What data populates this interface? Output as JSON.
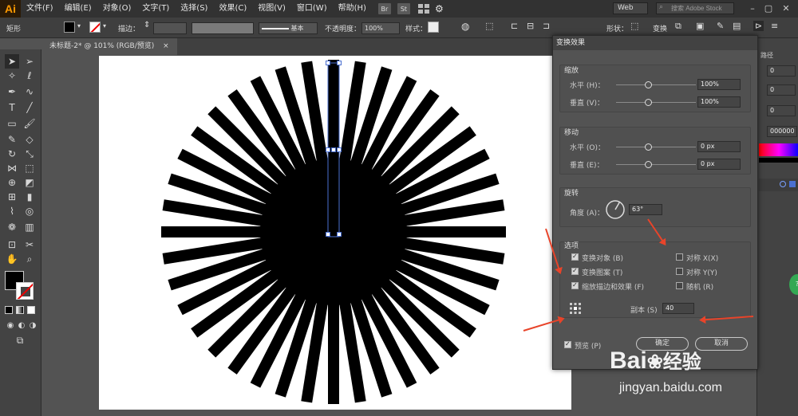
{
  "app": {
    "logo": "Ai",
    "menu": [
      "文件(F)",
      "编辑(E)",
      "对象(O)",
      "文字(T)",
      "选择(S)",
      "效果(C)",
      "视图(V)",
      "窗口(W)",
      "帮助(H)"
    ],
    "bridge_btn": "Br",
    "stock_btn": "St",
    "workspace": "Web",
    "stock_search_placeholder": "搜索 Adobe Stock"
  },
  "control_bar": {
    "object_type": "矩形",
    "stroke_label": "描边：",
    "stroke_style": "基本",
    "opacity_label": "不透明度：",
    "opacity_value": "100%",
    "style_label": "样式：",
    "shape_label": "形状：",
    "transform_label": "变换"
  },
  "document": {
    "tab_label": "未标题-2* @ 101% (RGB/预览)",
    "close_glyph": "×"
  },
  "right_panel": {
    "fields": [
      "0",
      "0",
      "0",
      "000000"
    ],
    "header_text": "路径"
  },
  "dialog": {
    "title": "变换效果",
    "scale": {
      "title": "缩放",
      "horizontal_label": "水平 (H)：",
      "horizontal_value": "100%",
      "vertical_label": "垂直 (V)：",
      "vertical_value": "100%"
    },
    "move": {
      "title": "移动",
      "horizontal_label": "水平 (O)：",
      "horizontal_value": "0 px",
      "vertical_label": "垂直 (E)：",
      "vertical_value": "0 px"
    },
    "rotate": {
      "title": "旋转",
      "angle_label": "角度 (A)：",
      "angle_value": "63°"
    },
    "options": {
      "title": "选项",
      "transform_objects": "变换对象 (B)",
      "transform_patterns": "变换图案 (T)",
      "scale_strokes": "缩放描边和效果 (F)",
      "reflect_x": "对称 X(X)",
      "reflect_y": "对称 Y(Y)",
      "random": "随机 (R)",
      "copies_label": "副本 (S)",
      "copies_value": "40"
    },
    "preview_label": "预览 (P)",
    "ok_label": "确定",
    "cancel_label": "取消"
  },
  "watermark": {
    "brand": "Bai",
    "brand_cn": "经验",
    "url": "jingyan.baidu.com"
  },
  "colors": {
    "annotation_arrow": "#e8442a",
    "selection_blue": "#4a6fd0",
    "artwork": "#000000"
  },
  "artwork": {
    "ray_count": 40
  }
}
